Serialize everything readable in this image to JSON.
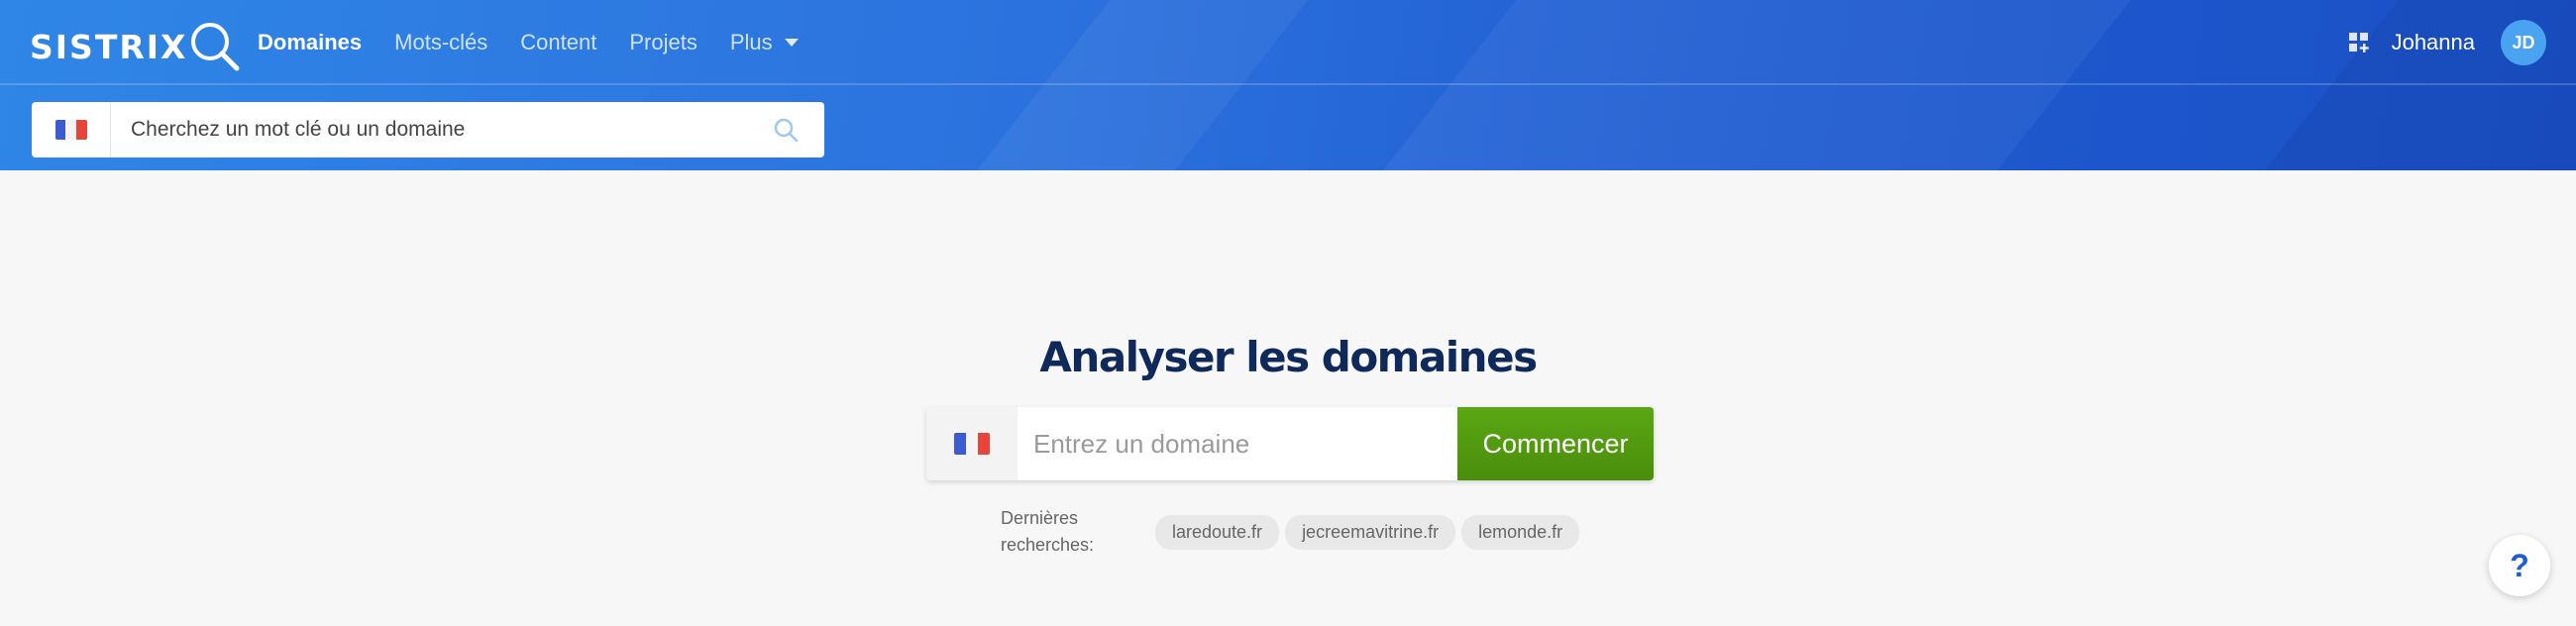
{
  "brand": {
    "name": "SISTRIX"
  },
  "nav": {
    "items": [
      {
        "label": "Domaines",
        "active": true
      },
      {
        "label": "Mots-clés",
        "active": false
      },
      {
        "label": "Content",
        "active": false
      },
      {
        "label": "Projets",
        "active": false
      },
      {
        "label": "Plus",
        "active": false
      }
    ]
  },
  "user": {
    "name": "Johanna",
    "initials": "JD"
  },
  "top_search": {
    "placeholder": "Cherchez un mot clé ou un domaine",
    "country": "fr-flag-icon"
  },
  "main": {
    "title": "Analyser les domaines",
    "domain_input_placeholder": "Entrez un domaine",
    "start_button": "Commencer",
    "recent_label": "Dernières recherches:",
    "recent_searches": [
      "laredoute.fr",
      "jecreemavitrine.fr",
      "lemonde.fr"
    ]
  },
  "help": {
    "label": "?"
  },
  "colors": {
    "header_start": "#2f86e6",
    "header_end": "#1a4fc6",
    "title": "#0f2a5a",
    "start_button": "#4f9a0f",
    "help_icon": "#1d5fd0"
  }
}
